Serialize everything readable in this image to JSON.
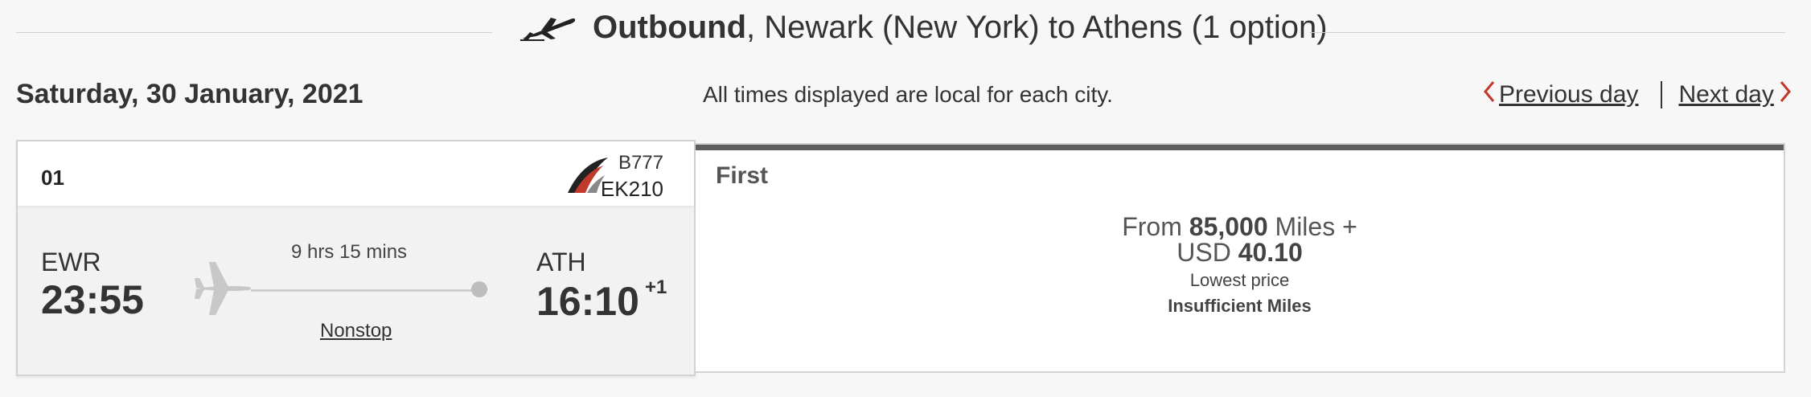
{
  "header": {
    "title_bold": "Outbound",
    "title_rest": ", Newark (New York) to Athens (1 option)",
    "icon": "airplane-takeoff-icon"
  },
  "date": "Saturday, 30 January, 2021",
  "timezone_note": "All times displayed are local for each city.",
  "nav": {
    "previous_label": "Previous day",
    "next_label": "Next day",
    "chevron_color": "#c0392b"
  },
  "flight": {
    "option_number": "01",
    "aircraft": "B777",
    "flight_number": "EK210",
    "departure": {
      "code": "EWR",
      "time": "23:55"
    },
    "arrival": {
      "code": "ATH",
      "time": "16:10",
      "day_offset": "+1"
    },
    "duration": "9 hrs 15 mins",
    "stops": "Nonstop"
  },
  "fare": {
    "class": "First",
    "from_label": "From",
    "miles": "85,000",
    "miles_label": "Miles +",
    "currency": "USD",
    "amount": "40.10",
    "price_note": "Lowest price",
    "status": "Insufficient Miles"
  },
  "colors": {
    "accent_red": "#c0392b",
    "fare_bar": "#5d5d5d"
  }
}
